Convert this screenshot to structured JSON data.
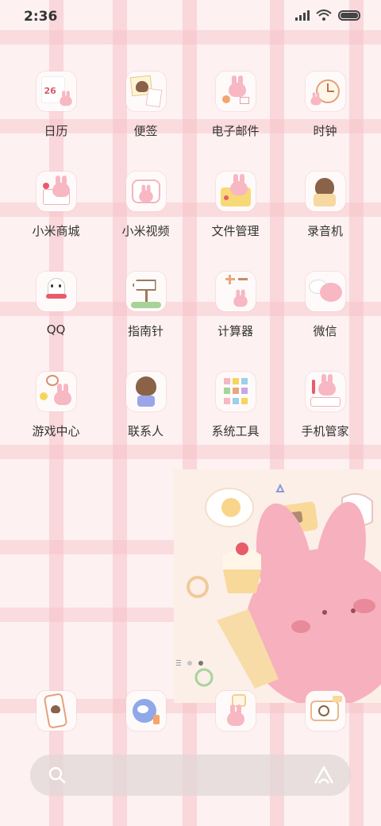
{
  "status_bar": {
    "time": "2:36"
  },
  "apps": [
    {
      "label": "日历",
      "icon": "calendar-icon",
      "badge": "26"
    },
    {
      "label": "便签",
      "icon": "notes-icon"
    },
    {
      "label": "电子邮件",
      "icon": "email-icon"
    },
    {
      "label": "时钟",
      "icon": "clock-icon"
    },
    {
      "label": "小米商城",
      "icon": "mi-store-icon"
    },
    {
      "label": "小米视频",
      "icon": "mi-video-icon"
    },
    {
      "label": "文件管理",
      "icon": "file-manager-icon"
    },
    {
      "label": "录音机",
      "icon": "recorder-icon"
    },
    {
      "label": "QQ",
      "icon": "qq-icon"
    },
    {
      "label": "指南针",
      "icon": "compass-icon"
    },
    {
      "label": "计算器",
      "icon": "calculator-icon"
    },
    {
      "label": "微信",
      "icon": "wechat-icon"
    },
    {
      "label": "游戏中心",
      "icon": "game-center-icon"
    },
    {
      "label": "联系人",
      "icon": "contacts-icon"
    },
    {
      "label": "系统工具",
      "icon": "system-tools-icon"
    },
    {
      "label": "手机管家",
      "icon": "security-icon"
    }
  ],
  "dock": [
    {
      "icon": "phone-icon"
    },
    {
      "icon": "browser-icon"
    },
    {
      "icon": "gallery-icon"
    },
    {
      "icon": "camera-icon"
    }
  ],
  "page_indicator": {
    "pages": 2,
    "active": 2
  },
  "colors": {
    "background": "#fdf1f1",
    "stripe": "#f6c2c8",
    "bunny_pink": "#f7b7c3"
  }
}
